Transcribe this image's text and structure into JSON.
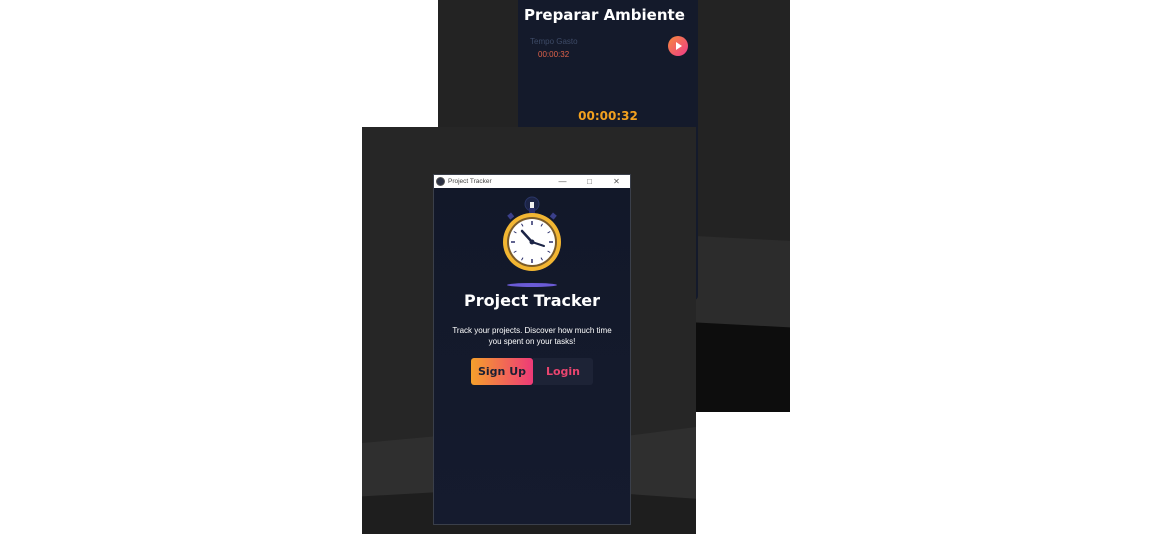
{
  "back_window": {
    "task_title": "Preparar Ambiente",
    "elapsed_label": "Tempo Gasto",
    "elapsed_value": "00:00:32",
    "total_time": "00:00:32",
    "play_icon": "play-icon"
  },
  "front_window": {
    "titlebar": {
      "title": "Project Tracker",
      "minimize": "—",
      "maximize": "□",
      "close": "✕"
    },
    "hero": {
      "app_name": "Project Tracker",
      "tagline": "Track your projects. Discover how much time you spent on your tasks!"
    },
    "buttons": {
      "signup_label": "Sign Up",
      "login_label": "Login"
    }
  },
  "colors": {
    "app_bg": "#131a2c",
    "accent_orange": "#f5a02b",
    "accent_pink": "#ee3a78",
    "timer_orange": "#f2a11f"
  }
}
